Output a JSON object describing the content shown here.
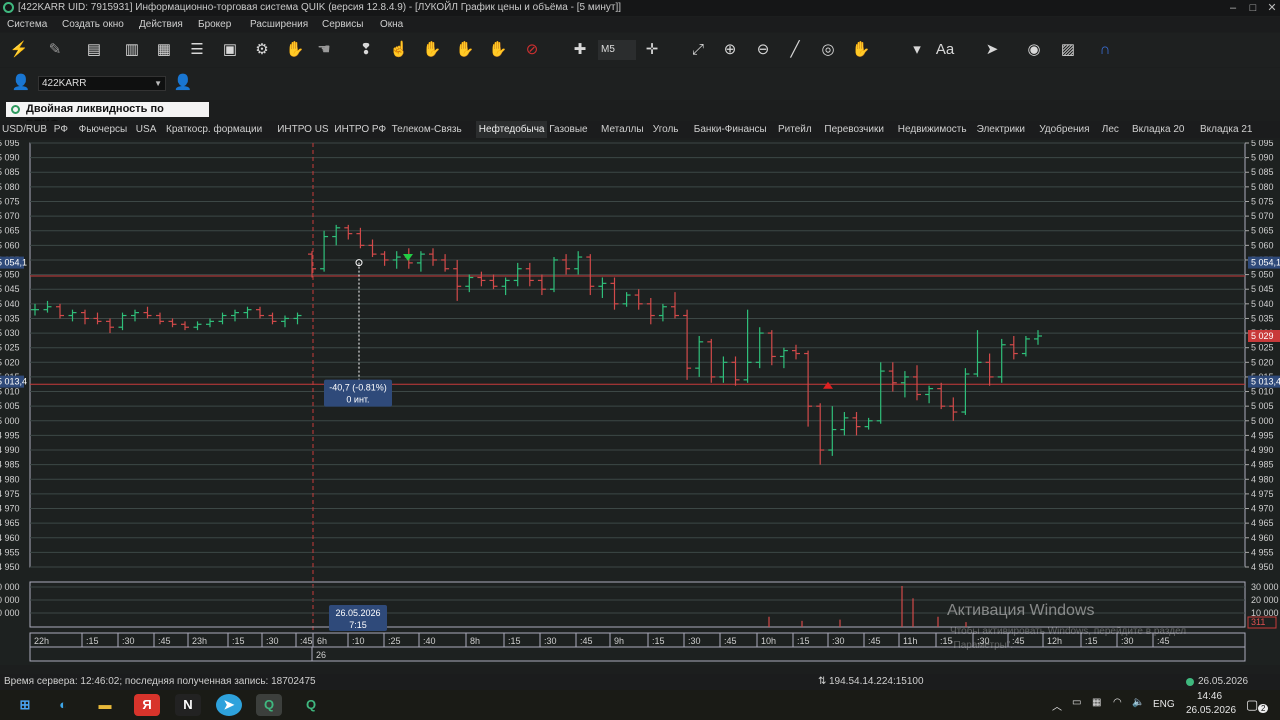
{
  "window": {
    "title": "[422KARR UID: 7915931] Информационно-торговая система QUIK (версия 12.8.4.9) - [ЛУКОЙЛ График цены и объёма - [5 минут]]",
    "min": "‒",
    "max": "□",
    "close": "✕"
  },
  "menu": [
    "Система",
    "Создать окно",
    "Действия",
    "Брокер",
    "Расширения",
    "Сервисы",
    "Окна"
  ],
  "toolbar": {
    "interval": "M5",
    "icons": [
      "disconnect-icon",
      "connect-icon",
      "new-table-icon",
      "chart-icon",
      "table-icon",
      "orders-icon",
      "save-icon",
      "settings-icon",
      "lock-icon",
      "alert-icon",
      "buy-icon",
      "sell-icon",
      "stop-icon",
      "pause-icon",
      "stop-order-icon",
      "add-instrument-icon",
      "crosshair-icon",
      "fullscreen-icon",
      "zoom-in-icon",
      "zoom-out-icon",
      "ruler-icon",
      "target-icon",
      "hand-icon",
      "text-size-icon",
      "draw-icon",
      "eye-icon",
      "grid-icon",
      "magnet-icon"
    ]
  },
  "account": {
    "value": "422KARR"
  },
  "banner": {
    "label": "Двойная ликвидность по БПИФ..."
  },
  "tabs": [
    "USD/RUB",
    "РФ",
    "Фьючерсы",
    "USA",
    "Краткоср. формации",
    "ИНТРО US",
    "ИНТРО РФ",
    "Телеком-Связь",
    "Нефтедобыча",
    "Газовые",
    "Металлы",
    "Уголь",
    "Банки-Финансы",
    "Ритейл",
    "Перевозчики",
    "Недвижимость",
    "Электрики",
    "Удобрения",
    "Лес",
    "Вкладка 20",
    "Вкладка 21"
  ],
  "active_tab": "Нефтедобыча",
  "chart_data": {
    "type": "bar",
    "title": "ЛУКОЙЛ График цены и объёма - [5 минут]",
    "price_axis": {
      "min": 4950,
      "max": 5095,
      "step": 5,
      "right_labels": [
        "5 095",
        "5 090",
        "5 085",
        "5 080",
        "5 075",
        "5 070",
        "5 065",
        "5 060",
        "5 055",
        "5 050",
        "5 045",
        "5 040",
        "5 035",
        "5 030",
        "5 025",
        "5 020",
        "5 015",
        "5 010",
        "5 005",
        "5 000",
        "4 995",
        "4 990",
        "4 985",
        "4 980",
        "4 975",
        "4 970",
        "4 965",
        "4 960",
        "4 955",
        "4 950"
      ],
      "left_labels": [
        "5 095",
        "5 090",
        "5 085",
        "5 080",
        "5 075",
        "5 070",
        "5 065",
        "5 060",
        "5 055",
        "5 050",
        "5 045",
        "5 040",
        "5 035",
        "5 030",
        "5 025",
        "5 020",
        "5 015",
        "5 010",
        "5 005",
        "5 000",
        "4 995",
        "4 990",
        "4 985",
        "4 980",
        "4 975",
        "4 970",
        "4 965",
        "4 960",
        "4 955",
        "4 950"
      ]
    },
    "hlines": [
      {
        "value": 5049.5,
        "color": "#c83a3a"
      },
      {
        "value": 5012.5,
        "color": "#c83a3a"
      }
    ],
    "price_badges": [
      {
        "side": "left",
        "text": "5 054,1",
        "value": 5054.1,
        "color": "#2f4a7a"
      },
      {
        "side": "right",
        "text": "5 054,1",
        "value": 5054.1,
        "color": "#2f4a7a"
      },
      {
        "side": "left",
        "text": "5 013,4",
        "value": 5013.4,
        "color": "#2f4a7a"
      },
      {
        "side": "right",
        "text": "5 013,4",
        "value": 5013.4,
        "color": "#2f4a7a"
      },
      {
        "side": "right",
        "text": "5 029",
        "value": 5029,
        "color": "#c83a3a"
      }
    ],
    "measure": {
      "text1": "-40,7 (-0.81%)",
      "text2": "0 инт.",
      "from": 5054.1,
      "to": 5013.4
    },
    "volume_axis": {
      "right_labels": [
        "30 000",
        "20 000",
        "10 000"
      ],
      "left_labels": [
        "0 000",
        "0 000",
        "0 000"
      ],
      "badge": "311"
    },
    "time_labels": [
      "22h",
      ":15",
      ":30",
      ":45",
      "23h",
      ":15",
      ":30",
      ":45",
      "6h",
      ":10",
      ":25",
      ":40",
      "8h",
      ":15",
      ":30",
      ":45",
      "9h",
      ":15",
      ":30",
      ":45",
      "10h",
      ":15",
      ":30",
      ":45",
      "11h",
      ":15",
      ":30",
      ":45",
      "12h",
      ":15",
      ":30",
      ":45"
    ],
    "date_row": "26",
    "cursor_date": "26.05.2026",
    "cursor_time": "7:15",
    "bars": [
      [
        5038,
        5040,
        5036,
        5038
      ],
      [
        5038,
        5041,
        5037,
        5039
      ],
      [
        5039,
        5040,
        5035,
        5036
      ],
      [
        5036,
        5038,
        5034,
        5037
      ],
      [
        5037,
        5038,
        5033,
        5035
      ],
      [
        5035,
        5037,
        5033,
        5034
      ],
      [
        5034,
        5035,
        5030,
        5032
      ],
      [
        5032,
        5037,
        5031,
        5036
      ],
      [
        5036,
        5038,
        5034,
        5037
      ],
      [
        5037,
        5039,
        5035,
        5036
      ],
      [
        5036,
        5037,
        5033,
        5034
      ],
      [
        5034,
        5035,
        5032,
        5033
      ],
      [
        5033,
        5034,
        5031,
        5032
      ],
      [
        5032,
        5034,
        5031,
        5033
      ],
      [
        5033,
        5035,
        5032,
        5034
      ],
      [
        5034,
        5037,
        5033,
        5036
      ],
      [
        5036,
        5038,
        5034,
        5037
      ],
      [
        5037,
        5039,
        5035,
        5038
      ],
      [
        5038,
        5039,
        5035,
        5036
      ],
      [
        5036,
        5037,
        5033,
        5034
      ],
      [
        5034,
        5036,
        5032,
        5035
      ],
      [
        5035,
        5037,
        5033,
        5036
      ],
      [
        5057,
        5058,
        5049,
        5052
      ],
      [
        5052,
        5065,
        5051,
        5063
      ],
      [
        5063,
        5067,
        5060,
        5066
      ],
      [
        5066,
        5067,
        5062,
        5064
      ],
      [
        5064,
        5066,
        5059,
        5060
      ],
      [
        5060,
        5062,
        5056,
        5057
      ],
      [
        5057,
        5058,
        5053,
        5055
      ],
      [
        5055,
        5058,
        5052,
        5056
      ],
      [
        5056,
        5059,
        5052,
        5054
      ],
      [
        5054,
        5058,
        5051,
        5057
      ],
      [
        5057,
        5059,
        5053,
        5055
      ],
      [
        5055,
        5057,
        5051,
        5052
      ],
      [
        5052,
        5055,
        5041,
        5046
      ],
      [
        5046,
        5050,
        5044,
        5049
      ],
      [
        5049,
        5051,
        5046,
        5048
      ],
      [
        5048,
        5050,
        5045,
        5046
      ],
      [
        5046,
        5049,
        5043,
        5048
      ],
      [
        5048,
        5054,
        5046,
        5052
      ],
      [
        5052,
        5054,
        5046,
        5048
      ],
      [
        5048,
        5050,
        5043,
        5045
      ],
      [
        5045,
        5056,
        5044,
        5055
      ],
      [
        5055,
        5057,
        5050,
        5052
      ],
      [
        5052,
        5058,
        5050,
        5056
      ],
      [
        5056,
        5057,
        5043,
        5046
      ],
      [
        5046,
        5049,
        5042,
        5047
      ],
      [
        5047,
        5049,
        5038,
        5040
      ],
      [
        5040,
        5044,
        5039,
        5043
      ],
      [
        5043,
        5045,
        5038,
        5040
      ],
      [
        5040,
        5042,
        5033,
        5036
      ],
      [
        5036,
        5040,
        5034,
        5039
      ],
      [
        5039,
        5044,
        5035,
        5036
      ],
      [
        5036,
        5038,
        5014,
        5018
      ],
      [
        5018,
        5029,
        5015,
        5027
      ],
      [
        5027,
        5028,
        5013,
        5015
      ],
      [
        5015,
        5022,
        5013,
        5020
      ],
      [
        5020,
        5022,
        5012,
        5014
      ],
      [
        5014,
        5038,
        5013,
        5020
      ],
      [
        5020,
        5032,
        5018,
        5030
      ],
      [
        5030,
        5031,
        5019,
        5022
      ],
      [
        5022,
        5025,
        5018,
        5024
      ],
      [
        5024,
        5026,
        5021,
        5023
      ],
      [
        5023,
        5024,
        4998,
        5005
      ],
      [
        5005,
        5006,
        4985,
        4990
      ],
      [
        4990,
        5005,
        4988,
        4997
      ],
      [
        4997,
        5003,
        4995,
        5001
      ],
      [
        5001,
        5003,
        4995,
        4998
      ],
      [
        4998,
        5001,
        4997,
        5000
      ],
      [
        5000,
        5020,
        4999,
        5017
      ],
      [
        5017,
        5020,
        5010,
        5013
      ],
      [
        5013,
        5017,
        5008,
        5015
      ],
      [
        5015,
        5019,
        5007,
        5009
      ],
      [
        5009,
        5012,
        5006,
        5011
      ],
      [
        5011,
        5013,
        5004,
        5005
      ],
      [
        5005,
        5008,
        5000,
        5003
      ],
      [
        5003,
        5018,
        5002,
        5016
      ],
      [
        5016,
        5031,
        5015,
        5020
      ],
      [
        5020,
        5023,
        5012,
        5015
      ],
      [
        5015,
        5028,
        5013,
        5026
      ],
      [
        5026,
        5029,
        5021,
        5023
      ],
      [
        5023,
        5029,
        5022,
        5028
      ],
      [
        5028,
        5031,
        5026,
        5029
      ]
    ]
  },
  "statusbar": {
    "left": "Время сервера: 12:46:02; последняя полученная запись: 18702475",
    "center": "194.54.14.224:15100",
    "right": "26.05.2026"
  },
  "watermark": {
    "title": "Активация Windows",
    "subtitle": "Чтобы активировать Windows, перейдите в раздел \"Параметры\"."
  },
  "taskbar": {
    "lang": "ENG",
    "time": "14:46",
    "date": "26.05.2026",
    "notif": "2"
  },
  "colors": {
    "up": "#2fbf7a",
    "down": "#d24a4a",
    "grid": "#3d4846",
    "bg": "#1d2120",
    "accent": "#3fb87f"
  }
}
